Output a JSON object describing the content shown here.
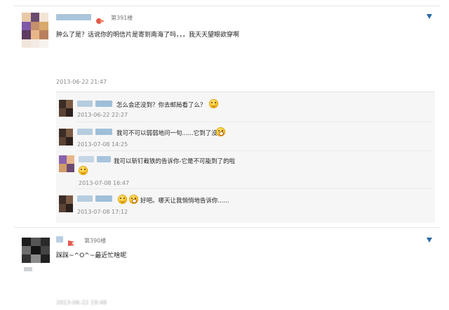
{
  "post1": {
    "floor": "第391楼",
    "content": "肿么了是？话说你的明信片是寄到南海了吗，，，我天天望眼欲穿啊",
    "time": "2013-06-22 21:47",
    "replies": [
      {
        "text": "怎么会还没到？你去邮局看了么？",
        "time": "2013-06-22 22:27"
      },
      {
        "text": "我可不可以弱弱地问一句......它到了没",
        "time": "2013-07-08 14:25"
      },
      {
        "text": "我可以斩钉截铁的告诉你-它是不可能到了的啦",
        "time": "2013-07-08 16:47"
      },
      {
        "text": "好吧。哪天让我悄悄地告诉你......",
        "time": "2013-07-08 17:12"
      }
    ]
  },
  "post2": {
    "floor": "第390楼",
    "content": "踩踩~^O^~最近忙啥呢",
    "time": "2013-06-22 19:48"
  },
  "colors": {
    "accent": "#2b6aa8",
    "divider": "#e6e6e6",
    "reply_bg": "#f6f6f6"
  },
  "icons": [
    "dropdown-arrow-icon",
    "floor-badge-icon",
    "smiley-emoji-icon",
    "avatar-mosaic"
  ]
}
